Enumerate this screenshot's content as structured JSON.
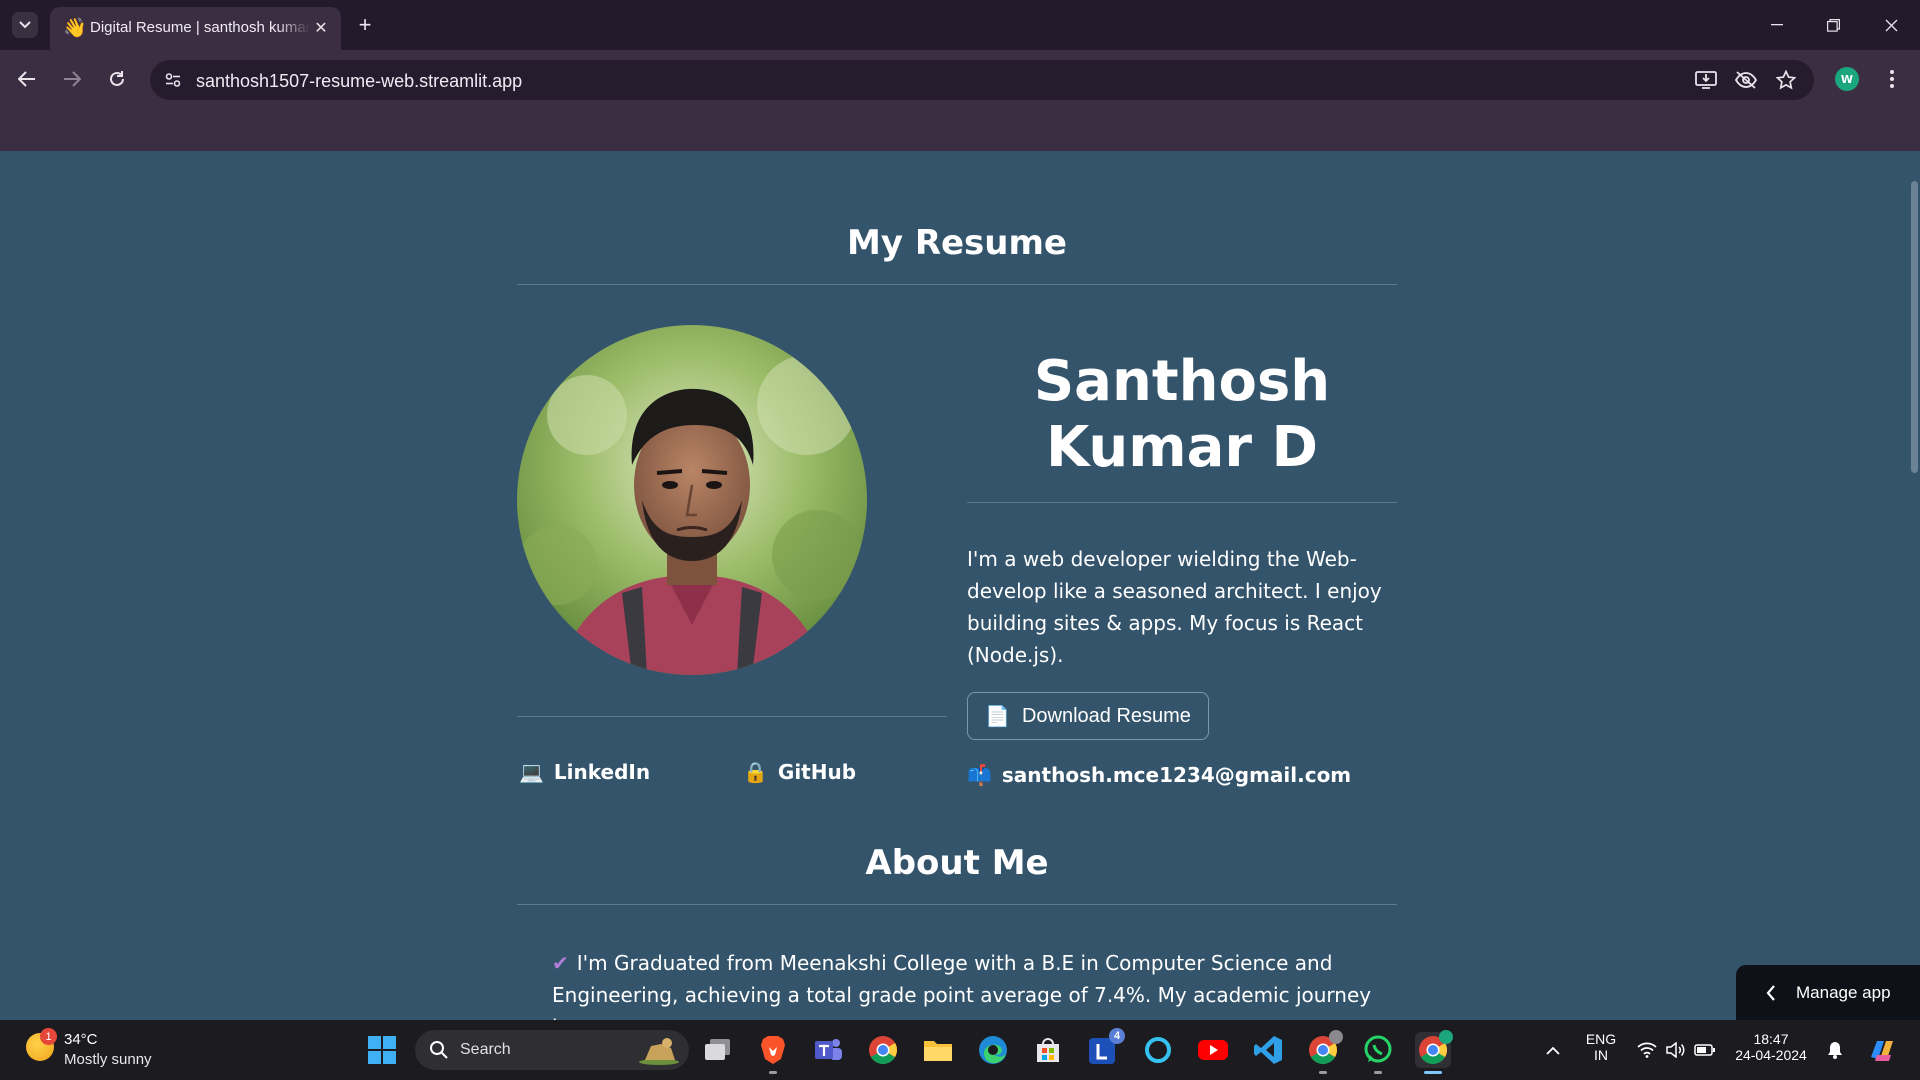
{
  "browser": {
    "tab_title": "Digital Resume | santhosh kumar",
    "tab_favicon": "👋",
    "url": "santhosh1507-resume-web.streamlit.app",
    "profile_initial": "W"
  },
  "page": {
    "resume_heading": "My Resume",
    "name": "Santhosh Kumar D",
    "bio": "I'm a web developer wielding the Web-develop like a seasoned architect. I enjoy building sites & apps. My focus is React (Node.js).",
    "download_button": {
      "icon": "📄",
      "label": "Download Resume"
    },
    "links": [
      {
        "icon": "💻",
        "label": "LinkedIn"
      },
      {
        "icon": "🔒",
        "label": "GitHub"
      }
    ],
    "email": {
      "icon": "📫",
      "label": "santhosh.mce1234@gmail.com"
    },
    "about_heading": "About Me",
    "about_text": "I'm Graduated from Meenakshi College with a B.E in Computer Science and Engineering, achieving a total grade point average of 7.4%. My academic journey has",
    "about_check": "✔"
  },
  "streamlit": {
    "manage_app_label": "Manage app"
  },
  "taskbar": {
    "weather": {
      "badge": "1",
      "temp": "34°C",
      "condition": "Mostly sunny"
    },
    "search_placeholder": "Search",
    "teams_badge": "4",
    "language": {
      "line1": "ENG",
      "line2": "IN"
    },
    "clock": {
      "time": "18:47",
      "date": "24-04-2024"
    }
  },
  "colors": {
    "page_bg": "#34546b",
    "chrome_bg": "#3b2e42",
    "tabstrip_bg": "#231a2b",
    "accent_check": "#b07ed8",
    "taskbar_bg": "#1c1c20"
  }
}
